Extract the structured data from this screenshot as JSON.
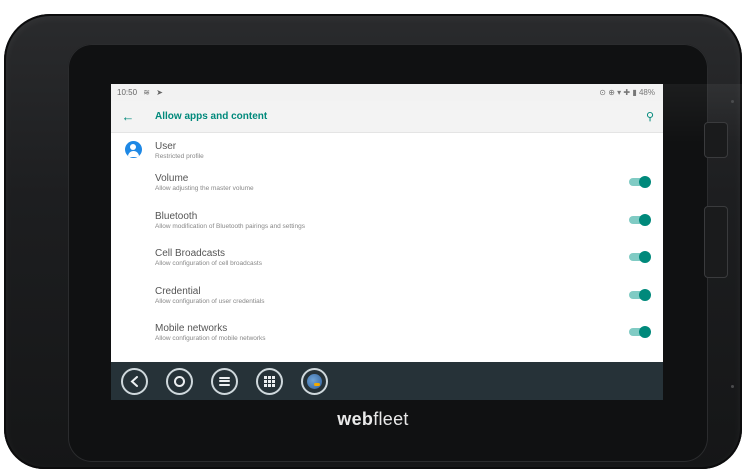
{
  "device": {
    "brand_prefix": "web",
    "brand_suffix": "fleet"
  },
  "status_bar": {
    "time": "10:50",
    "left_icons": [
      "notification-icon",
      "navigation-arrow-icon"
    ],
    "right_icons": [
      "location-icon",
      "sync-icon",
      "wifi-icon",
      "battery-icon"
    ],
    "battery": "48%"
  },
  "app_bar": {
    "back_icon": "arrow-back-icon",
    "title": "Allow apps and content",
    "search_icon": "search-icon"
  },
  "user": {
    "name": "User",
    "subtitle": "Restricted profile"
  },
  "settings": [
    {
      "title": "Volume",
      "subtitle": "Allow adjusting the master volume",
      "enabled": true
    },
    {
      "title": "Bluetooth",
      "subtitle": "Allow modification of Bluetooth pairings and settings",
      "enabled": true
    },
    {
      "title": "Cell Broadcasts",
      "subtitle": "Allow configuration of cell broadcasts",
      "enabled": true
    },
    {
      "title": "Credential",
      "subtitle": "Allow configuration of user credentials",
      "enabled": true
    },
    {
      "title": "Mobile networks",
      "subtitle": "Allow configuration of mobile networks",
      "enabled": true
    }
  ],
  "nav_bar": {
    "buttons": [
      "back-icon",
      "home-icon",
      "menu-icon",
      "apps-grid-icon",
      "globe-icon"
    ]
  },
  "colors": {
    "accent": "#00897b",
    "toggle_track": "#80cbc4",
    "nav_bar": "#263238",
    "avatar": "#1e88e5"
  }
}
